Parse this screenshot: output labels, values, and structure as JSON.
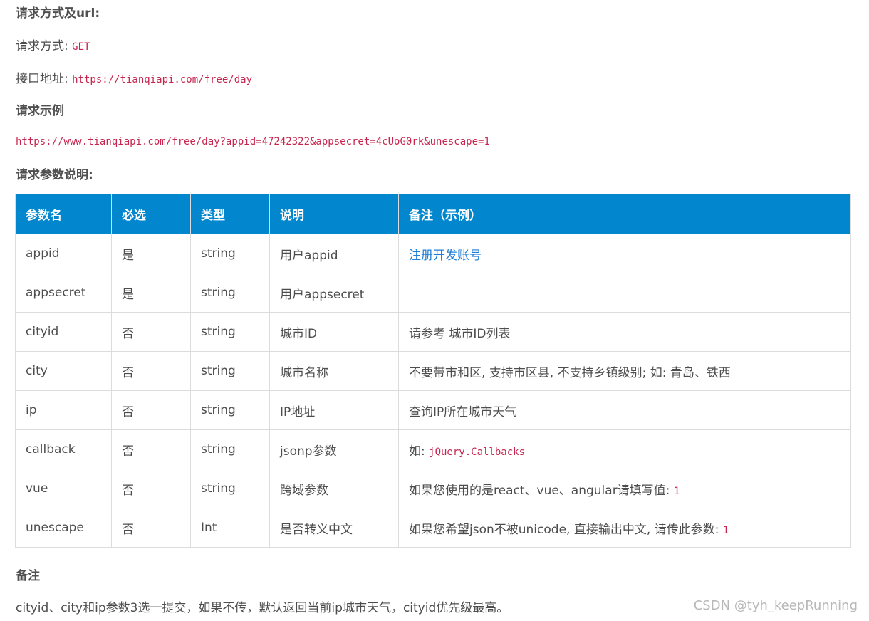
{
  "section_request": {
    "heading": "请求方式及url:",
    "method_label": "请求方式:",
    "method_value": "GET",
    "url_label": "接口地址:",
    "url_value": "https://tianqiapi.com/free/day"
  },
  "section_example": {
    "heading": "请求示例",
    "example_url": "https://www.tianqiapi.com/free/day?appid=47242322&appsecret=4cUoG0rk&unescape=1"
  },
  "section_params": {
    "heading": "请求参数说明:",
    "columns": [
      "参数名",
      "必选",
      "类型",
      "说明",
      "备注（示例）"
    ],
    "rows": [
      {
        "name": "appid",
        "required": "是",
        "type": "string",
        "desc": "用户appid",
        "note": "",
        "note_link": "注册开发账号",
        "note_code": ""
      },
      {
        "name": "appsecret",
        "required": "是",
        "type": "string",
        "desc": "用户appsecret",
        "note": "",
        "note_link": "",
        "note_code": ""
      },
      {
        "name": "cityid",
        "required": "否",
        "type": "string",
        "desc": "城市ID",
        "note": "请参考 城市ID列表",
        "note_link": "",
        "note_code": ""
      },
      {
        "name": "city",
        "required": "否",
        "type": "string",
        "desc": "城市名称",
        "note": "不要带市和区, 支持市区县, 不支持乡镇级别; 如: 青岛、铁西",
        "note_link": "",
        "note_code": ""
      },
      {
        "name": "ip",
        "required": "否",
        "type": "string",
        "desc": "IP地址",
        "note": "查询IP所在城市天气",
        "note_link": "",
        "note_code": ""
      },
      {
        "name": "callback",
        "required": "否",
        "type": "string",
        "desc": "jsonp参数",
        "note": "如: ",
        "note_link": "",
        "note_code": "jQuery.Callbacks"
      },
      {
        "name": "vue",
        "required": "否",
        "type": "string",
        "desc": "跨域参数",
        "note": "如果您使用的是react、vue、angular请填写值: ",
        "note_link": "",
        "note_code": "1"
      },
      {
        "name": "unescape",
        "required": "否",
        "type": "Int",
        "desc": "是否转义中文",
        "note": "如果您希望json不被unicode, 直接输出中文, 请传此参数: ",
        "note_link": "",
        "note_code": "1"
      }
    ]
  },
  "section_remarks": {
    "heading": "备注",
    "text": "cityid、city和ip参数3选一提交，如果不传，默认返回当前ip城市天气，cityid优先级最高。"
  },
  "watermark": "CSDN @tyh_keepRunning",
  "colors": {
    "header_bg": "#0287cf",
    "code": "#c7254e",
    "link": "#1f7fd6"
  }
}
